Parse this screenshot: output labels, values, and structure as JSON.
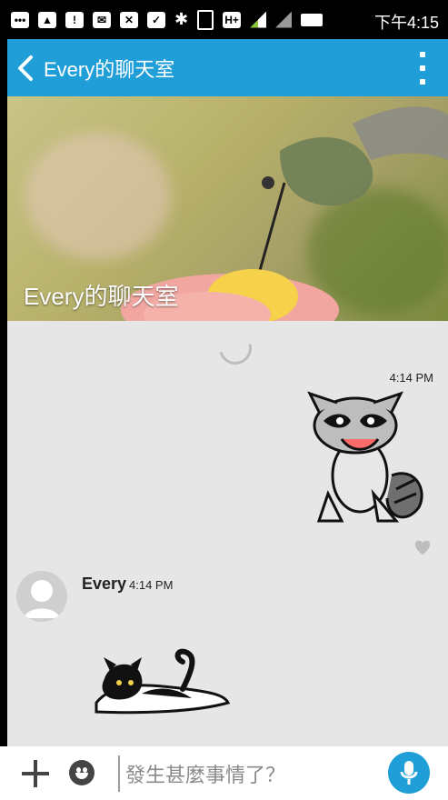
{
  "status_bar": {
    "time": "下午4:15",
    "network_label": "H+"
  },
  "app_bar": {
    "title": "Every的聊天室",
    "accent_color": "#1f9ed8"
  },
  "hero": {
    "title": "Every的聊天室"
  },
  "chat": {
    "messages": [
      {
        "time": "4:14 PM",
        "side": "right",
        "content_type": "sticker",
        "sticker": "raccoon-sticker"
      },
      {
        "sender": "Every",
        "time": "4:14 PM",
        "side": "left",
        "content_type": "sticker",
        "sticker": "cat-sticker"
      }
    ]
  },
  "input": {
    "placeholder": "發生甚麼事情了？"
  }
}
